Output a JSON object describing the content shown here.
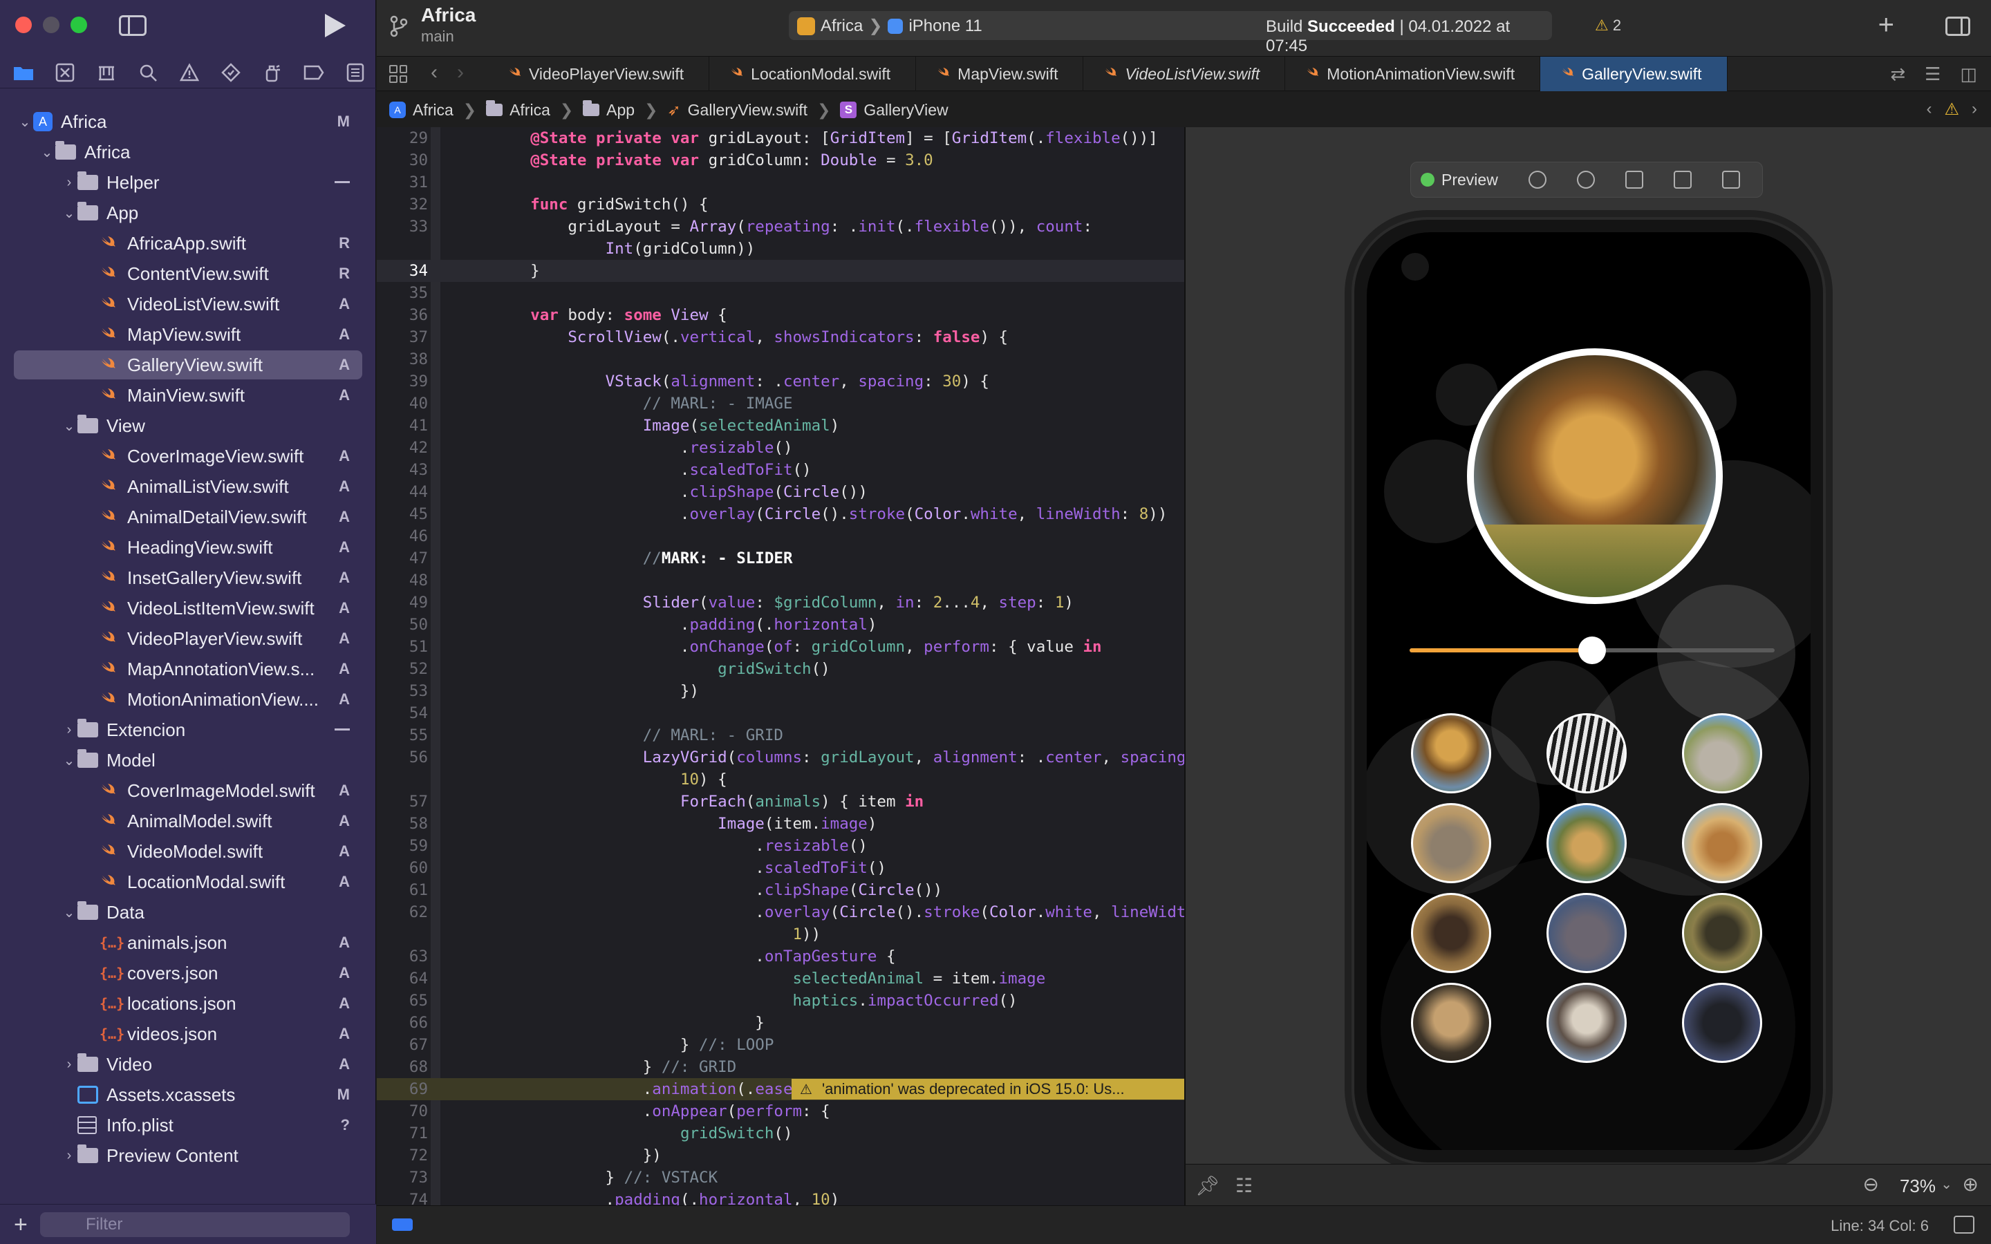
{
  "sidebar": {
    "filter_placeholder": "Filter",
    "tree": [
      {
        "label": "Africa",
        "type": "project",
        "depth": 0,
        "open": true,
        "badge": "M"
      },
      {
        "label": "Africa",
        "type": "folder",
        "depth": 1,
        "open": true,
        "badge": ""
      },
      {
        "label": "Helper",
        "type": "folder",
        "depth": 2,
        "open": false,
        "badge": "–"
      },
      {
        "label": "App",
        "type": "folder",
        "depth": 2,
        "open": true,
        "badge": ""
      },
      {
        "label": "AfricaApp.swift",
        "type": "swift",
        "depth": 3,
        "badge": "R"
      },
      {
        "label": "ContentView.swift",
        "type": "swift",
        "depth": 3,
        "badge": "R"
      },
      {
        "label": "VideoListView.swift",
        "type": "swift",
        "depth": 3,
        "badge": "A"
      },
      {
        "label": "MapView.swift",
        "type": "swift",
        "depth": 3,
        "badge": "A"
      },
      {
        "label": "GalleryView.swift",
        "type": "swift",
        "depth": 3,
        "badge": "A",
        "selected": true
      },
      {
        "label": "MainView.swift",
        "type": "swift",
        "depth": 3,
        "badge": "A"
      },
      {
        "label": "View",
        "type": "folder",
        "depth": 2,
        "open": true,
        "badge": ""
      },
      {
        "label": "CoverImageView.swift",
        "type": "swift",
        "depth": 3,
        "badge": "A"
      },
      {
        "label": "AnimalListView.swift",
        "type": "swift",
        "depth": 3,
        "badge": "A"
      },
      {
        "label": "AnimalDetailView.swift",
        "type": "swift",
        "depth": 3,
        "badge": "A"
      },
      {
        "label": "HeadingView.swift",
        "type": "swift",
        "depth": 3,
        "badge": "A"
      },
      {
        "label": "InsetGalleryView.swift",
        "type": "swift",
        "depth": 3,
        "badge": "A"
      },
      {
        "label": "VideoListItemView.swift",
        "type": "swift",
        "depth": 3,
        "badge": "A"
      },
      {
        "label": "VideoPlayerView.swift",
        "type": "swift",
        "depth": 3,
        "badge": "A"
      },
      {
        "label": "MapAnnotationView.s...",
        "type": "swift",
        "depth": 3,
        "badge": "A"
      },
      {
        "label": "MotionAnimationView....",
        "type": "swift",
        "depth": 3,
        "badge": "A"
      },
      {
        "label": "Extencion",
        "type": "folder",
        "depth": 2,
        "open": false,
        "badge": "–"
      },
      {
        "label": "Model",
        "type": "folder",
        "depth": 2,
        "open": true,
        "badge": ""
      },
      {
        "label": "CoverImageModel.swift",
        "type": "swift",
        "depth": 3,
        "badge": "A"
      },
      {
        "label": "AnimalModel.swift",
        "type": "swift",
        "depth": 3,
        "badge": "A"
      },
      {
        "label": "VideoModel.swift",
        "type": "swift",
        "depth": 3,
        "badge": "A"
      },
      {
        "label": "LocationModal.swift",
        "type": "swift",
        "depth": 3,
        "badge": "A"
      },
      {
        "label": "Data",
        "type": "folder",
        "depth": 2,
        "open": true,
        "badge": ""
      },
      {
        "label": "animals.json",
        "type": "json",
        "depth": 3,
        "badge": "A"
      },
      {
        "label": "covers.json",
        "type": "json",
        "depth": 3,
        "badge": "A"
      },
      {
        "label": "locations.json",
        "type": "json",
        "depth": 3,
        "badge": "A"
      },
      {
        "label": "videos.json",
        "type": "json",
        "depth": 3,
        "badge": "A"
      },
      {
        "label": "Video",
        "type": "folder",
        "depth": 2,
        "open": false,
        "badge": "A"
      },
      {
        "label": "Assets.xcassets",
        "type": "assets",
        "depth": 2,
        "badge": "M"
      },
      {
        "label": "Info.plist",
        "type": "plist",
        "depth": 2,
        "badge": "?"
      },
      {
        "label": "Preview Content",
        "type": "folder",
        "depth": 2,
        "open": false,
        "badge": ""
      }
    ]
  },
  "toolbar": {
    "project": "Africa",
    "branch": "main",
    "scheme": "Africa",
    "device": "iPhone 11",
    "build_prefix": "Build ",
    "build_result": "Succeeded",
    "build_time": " | 04.01.2022 at 07:45",
    "warnings": "2"
  },
  "tabs": [
    {
      "label": "VideoPlayerView.swift",
      "active": false,
      "italic": false
    },
    {
      "label": "LocationModal.swift",
      "active": false,
      "italic": false
    },
    {
      "label": "MapView.swift",
      "active": false,
      "italic": false
    },
    {
      "label": "VideoListView.swift",
      "active": false,
      "italic": true
    },
    {
      "label": "MotionAnimationView.swift",
      "active": false,
      "italic": false
    },
    {
      "label": "GalleryView.swift",
      "active": true,
      "italic": false
    }
  ],
  "jumpbar": [
    "Africa",
    "Africa",
    "App",
    "GalleryView.swift",
    "GalleryView"
  ],
  "editor": {
    "current_line": 34,
    "warning_line": 69,
    "warning_text": "'animation' was deprecated in iOS 15.0: Us...",
    "lines": [
      {
        "n": "29",
        "html": "    <span class='kw'>@State</span> <span class='kw'>private</span> <span class='kw'>var</span> gridLayout: [<span class='ty'>GridItem</span>] = [<span class='ty'>GridItem</span>(.<span class='fn'>flexible</span>())]"
      },
      {
        "n": "30",
        "html": "    <span class='kw'>@State</span> <span class='kw'>private</span> <span class='kw'>var</span> gridColumn: <span class='ty'>Double</span> = <span class='nu'>3.0</span>"
      },
      {
        "n": "31",
        "html": ""
      },
      {
        "n": "32",
        "html": "    <span class='kw'>func</span> gridSwitch() {"
      },
      {
        "n": "33",
        "html": "        gridLayout = <span class='ty'>Array</span>(<span class='fn'>repeating</span>: .<span class='fn'>init</span>(.<span class='fn'>flexible</span>()), <span class='fn'>count</span>:"
      },
      {
        "n": "",
        "html": "            <span class='ty'>Int</span>(gridColumn))"
      },
      {
        "n": "34",
        "html": "    }"
      },
      {
        "n": "35",
        "html": ""
      },
      {
        "n": "36",
        "html": "    <span class='kw'>var</span> body: <span class='kw'>some</span> <span class='ty'>View</span> {"
      },
      {
        "n": "37",
        "html": "        <span class='ty'>ScrollView</span>(.<span class='fn'>vertical</span>, <span class='fn'>showsIndicators</span>: <span class='kw'>false</span>) {"
      },
      {
        "n": "38",
        "html": ""
      },
      {
        "n": "39",
        "html": "            <span class='ty'>VStack</span>(<span class='fn'>alignment</span>: .<span class='fn'>center</span>, <span class='fn'>spacing</span>: <span class='nu'>30</span>) {"
      },
      {
        "n": "40",
        "html": "                <span class='cm'>// MARL: - IMAGE</span>"
      },
      {
        "n": "41",
        "html": "                <span class='ty'>Image</span>(<span class='bl'>selectedAnimal</span>)"
      },
      {
        "n": "42",
        "html": "                    .<span class='fn'>resizable</span>()"
      },
      {
        "n": "43",
        "html": "                    .<span class='fn'>scaledToFit</span>()"
      },
      {
        "n": "44",
        "html": "                    .<span class='fn'>clipShape</span>(<span class='ty'>Circle</span>())"
      },
      {
        "n": "45",
        "html": "                    .<span class='fn'>overlay</span>(<span class='ty'>Circle</span>().<span class='fn'>stroke</span>(<span class='ty'>Color</span>.<span class='fn'>white</span>, <span class='fn'>lineWidth</span>: <span class='nu'>8</span>))"
      },
      {
        "n": "46",
        "html": ""
      },
      {
        "n": "47",
        "html": "                <span class='cm'>//</span><span class='wv'>MARK: - SLIDER</span>"
      },
      {
        "n": "48",
        "html": ""
      },
      {
        "n": "49",
        "html": "                <span class='ty'>Slider</span>(<span class='fn'>value</span>: <span class='bl'>$gridColumn</span>, <span class='fn'>in</span>: <span class='nu'>2</span>...<span class='nu'>4</span>, <span class='fn'>step</span>: <span class='nu'>1</span>)"
      },
      {
        "n": "50",
        "html": "                    .<span class='fn'>padding</span>(.<span class='fn'>horizontal</span>)"
      },
      {
        "n": "51",
        "html": "                    .<span class='fn'>onChange</span>(<span class='fn'>of</span>: <span class='bl'>gridColumn</span>, <span class='fn'>perform</span>: { value <span class='kw'>in</span>"
      },
      {
        "n": "52",
        "html": "                        <span class='bl'>gridSwitch</span>()"
      },
      {
        "n": "53",
        "html": "                    })"
      },
      {
        "n": "54",
        "html": ""
      },
      {
        "n": "55",
        "html": "                <span class='cm'>// MARL: - GRID</span>"
      },
      {
        "n": "56",
        "html": "                <span class='ty'>LazyVGrid</span>(<span class='fn'>columns</span>: <span class='bl'>gridLayout</span>, <span class='fn'>alignment</span>: .<span class='fn'>center</span>, <span class='fn'>spacing</span>:"
      },
      {
        "n": "",
        "html": "                    <span class='nu'>10</span>) {"
      },
      {
        "n": "57",
        "html": "                    <span class='ty'>ForEach</span>(<span class='bl'>animals</span>) { item <span class='kw'>in</span>"
      },
      {
        "n": "58",
        "html": "                        <span class='ty'>Image</span>(item.<span class='fn'>image</span>)"
      },
      {
        "n": "59",
        "html": "                            .<span class='fn'>resizable</span>()"
      },
      {
        "n": "60",
        "html": "                            .<span class='fn'>scaledToFit</span>()"
      },
      {
        "n": "61",
        "html": "                            .<span class='fn'>clipShape</span>(<span class='ty'>Circle</span>())"
      },
      {
        "n": "62",
        "html": "                            .<span class='fn'>overlay</span>(<span class='ty'>Circle</span>().<span class='fn'>stroke</span>(<span class='ty'>Color</span>.<span class='fn'>white</span>, <span class='fn'>lineWidth</span>:"
      },
      {
        "n": "",
        "html": "                                <span class='nu'>1</span>))"
      },
      {
        "n": "63",
        "html": "                            .<span class='fn'>onTapGesture</span> {"
      },
      {
        "n": "64",
        "html": "                                <span class='bl'>selectedAnimal</span> = item.<span class='fn'>image</span>"
      },
      {
        "n": "65",
        "html": "                                <span class='bl'>haptics</span>.<span class='fn'>impactOccurred</span>()"
      },
      {
        "n": "66",
        "html": "                            }"
      },
      {
        "n": "67",
        "html": "                    } <span class='cm'>//: LOOP</span>"
      },
      {
        "n": "68",
        "html": "                } <span class='cm'>//: GRID</span>"
      },
      {
        "n": "69",
        "html": "                .<span class='fn'>animation</span>(.<span class='fn'>easeIn</span>)"
      },
      {
        "n": "70",
        "html": "                .<span class='fn'>onAppear</span>(<span class='fn'>perform</span>: {"
      },
      {
        "n": "71",
        "html": "                    <span class='bl'>gridSwitch</span>()"
      },
      {
        "n": "72",
        "html": "                })"
      },
      {
        "n": "73",
        "html": "            } <span class='cm'>//: VSTACK</span>"
      },
      {
        "n": "74",
        "html": "            .<span class='fn'>padding</span>(.<span class='fn'>horizontal</span>, <span class='nu'>10</span>)"
      }
    ]
  },
  "canvas": {
    "preview_label": "Preview",
    "slider_value": 3,
    "slider_min": 2,
    "slider_max": 4,
    "zoom": "73%"
  },
  "status": {
    "cursor": "Line: 34  Col: 6"
  },
  "colors": {
    "accent": "#3478f6",
    "sidebar_bg": "#332c52",
    "swift_orange": "#f0883e",
    "slider": "#f3a43a",
    "warning": "#c7a93a"
  }
}
